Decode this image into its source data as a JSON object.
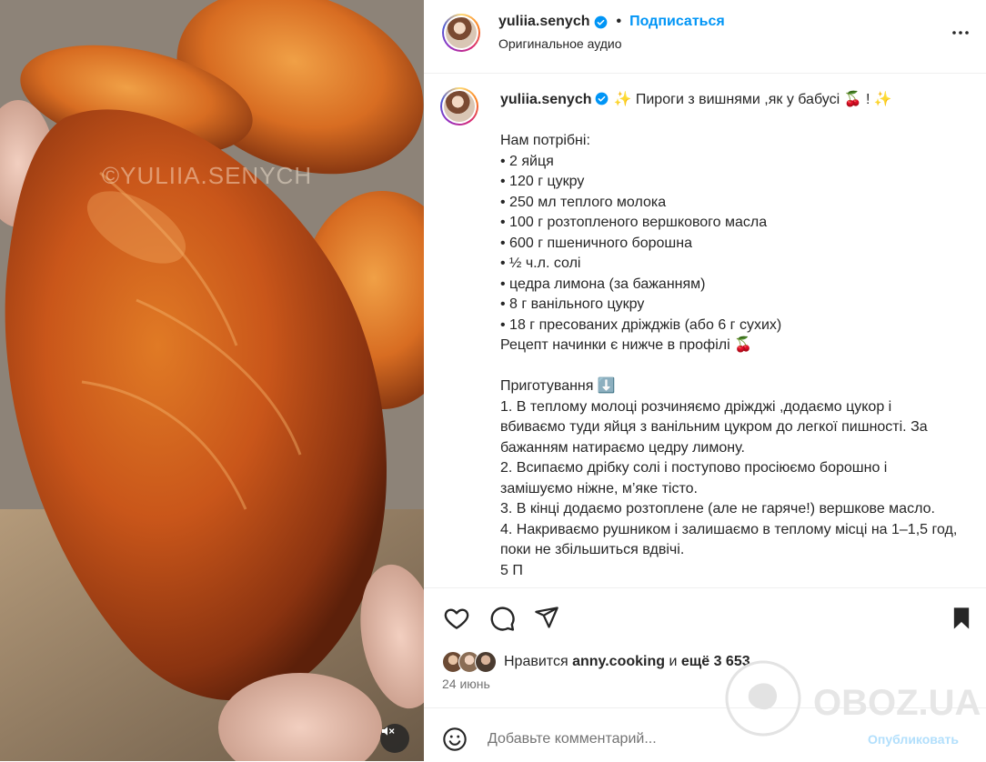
{
  "media": {
    "watermark": "©YULIIA.SENYCH",
    "mute_icon": "speaker-muted-icon"
  },
  "header": {
    "username": "yuliia.senych",
    "separator": "•",
    "follow_label": "Подписаться",
    "audio_label": "Оригинальное аудио",
    "more_icon": "more-horizontal-icon"
  },
  "caption": {
    "username": "yuliia.senych",
    "text": "✨ Пироги з вишнями ,як у бабусі 🍒 ! ✨\n\nНам потрібні:\n• 2 яйця\n• 120 г цукру\n• 250 мл теплого молока\n• 100 г розтопленого вершкового масла\n• 600 г пшеничного борошна\n• ½ ч.л. солі\n• цедра лимона (за бажанням)\n• 8 г ванільного цукру\n• 18 г пресованих дріжджів (або 6 г сухих)\nРецепт начинки є нижче в профілі 🍒\n\nПриготування ⬇️\n1. В теплому молоці розчиняємо дріжджі ,додаємо цукор і вбиваємо туди яйця з ванільним цукром до легкої пишності. За бажанням натираємо цедру лимону.\n2. Всипаємо дрібку солі і поступово просіюємо борошно і замішуємо ніжне, м’яке тісто.\n3. В кінці додаємо розтоплене (але не гаряче!) вершкове масло.\n4. Накриваємо рушником і залишаємо в теплому місці на 1–1,5 год, поки не збільшиться вдвічі.\n5 П"
  },
  "actions": {
    "like_icon": "heart-icon",
    "comment_icon": "comment-icon",
    "share_icon": "send-icon",
    "save_icon": "bookmark-icon"
  },
  "likes": {
    "prefix": "Нравится",
    "user": "anny.cooking",
    "middle": "и",
    "count": "ещё 3 653"
  },
  "date": "24 июнь",
  "comment": {
    "placeholder": "Добавьте комментарий...",
    "post_label": "Опубликовать",
    "emoji_icon": "emoji-icon"
  },
  "colors": {
    "accent": "#0095f6",
    "post_disabled": "#b2dffc",
    "text": "#262626",
    "muted": "#737373"
  }
}
